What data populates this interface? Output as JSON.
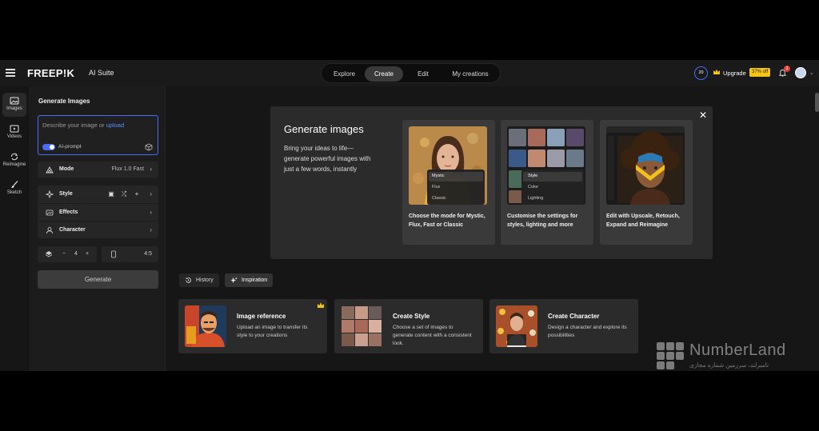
{
  "header": {
    "brand": "FREEP!K",
    "suite": "AI Suite",
    "tabs": [
      {
        "label": "Explore",
        "active": false
      },
      {
        "label": "Create",
        "active": true
      },
      {
        "label": "Edit",
        "active": false
      },
      {
        "label": "My creations",
        "active": false
      }
    ],
    "credits": "20",
    "upgrade_label": "Upgrade",
    "discount_badge": "37% off",
    "notification_count": "3"
  },
  "rail": [
    {
      "label": "Images",
      "icon": "image-icon",
      "active": true
    },
    {
      "label": "Videos",
      "icon": "video-icon",
      "active": false
    },
    {
      "label": "Reimagine",
      "icon": "reimagine-icon",
      "active": false
    },
    {
      "label": "Sketch",
      "icon": "brush-icon",
      "active": false
    }
  ],
  "panel": {
    "title": "Generate Images",
    "prompt_placeholder": "Describe your image or",
    "prompt_link": "upload",
    "ai_prompt_label": "AI-prompt",
    "ai_prompt_on": true,
    "mode_label": "Mode",
    "mode_value": "Flux 1.0 Fast",
    "style_label": "Style",
    "effects_label": "Effects",
    "character_label": "Character",
    "count_minus": "−",
    "count_value": "4",
    "count_plus": "+",
    "ratio_value": "4:5",
    "generate_label": "Generate"
  },
  "modal": {
    "title": "Generate images",
    "description": "Bring your ideas to life—generate powerful images with just a few words, instantly",
    "cards": [
      {
        "text": "Choose the mode for Mystic, Flux, Fast or Classic",
        "options": [
          "Mystic",
          "Flux",
          "Classic"
        ]
      },
      {
        "text": "Customise the settings for styles, lighting and more",
        "options": [
          "Style",
          "Color",
          "Lighting"
        ]
      },
      {
        "text": "Edit with Upscale, Retouch, Expand and Reimagine"
      }
    ]
  },
  "tabs": [
    {
      "label": "History",
      "icon": "history-icon",
      "active": false
    },
    {
      "label": "Inspiration",
      "icon": "sparkle-icon",
      "active": true
    }
  ],
  "inspiration": [
    {
      "title": "Image reference",
      "desc": "Upload an image to transfer its style to your creations",
      "premium": true
    },
    {
      "title": "Create Style",
      "desc": "Choose a set of images to generate content with a consistent look.",
      "premium": false
    },
    {
      "title": "Create Character",
      "desc": "Design a character and explore its possibilities",
      "premium": false
    }
  ],
  "watermark": {
    "name": "NumberLand",
    "sub": "نامبرلند، سرزمین شماره مجازی"
  },
  "colors": {
    "accent": "#4a6cf7",
    "badge": "#f5c518",
    "background": "#161616",
    "card": "#2b2b2b"
  }
}
